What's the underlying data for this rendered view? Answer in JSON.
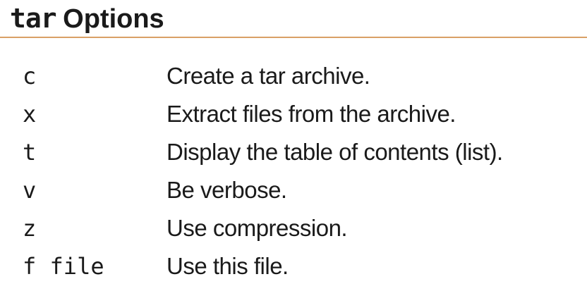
{
  "slide": {
    "title_command": "tar",
    "title_text": "Options",
    "accent_color": "#d9a066",
    "options": [
      {
        "flag": "c",
        "description": "Create a tar archive."
      },
      {
        "flag": "x",
        "description": "Extract files from the archive."
      },
      {
        "flag": "t",
        "description": "Display the table of contents (list)."
      },
      {
        "flag": "v",
        "description": "Be verbose."
      },
      {
        "flag": "z",
        "description": "Use compression."
      },
      {
        "flag": "f file",
        "description": "Use this file."
      }
    ]
  }
}
